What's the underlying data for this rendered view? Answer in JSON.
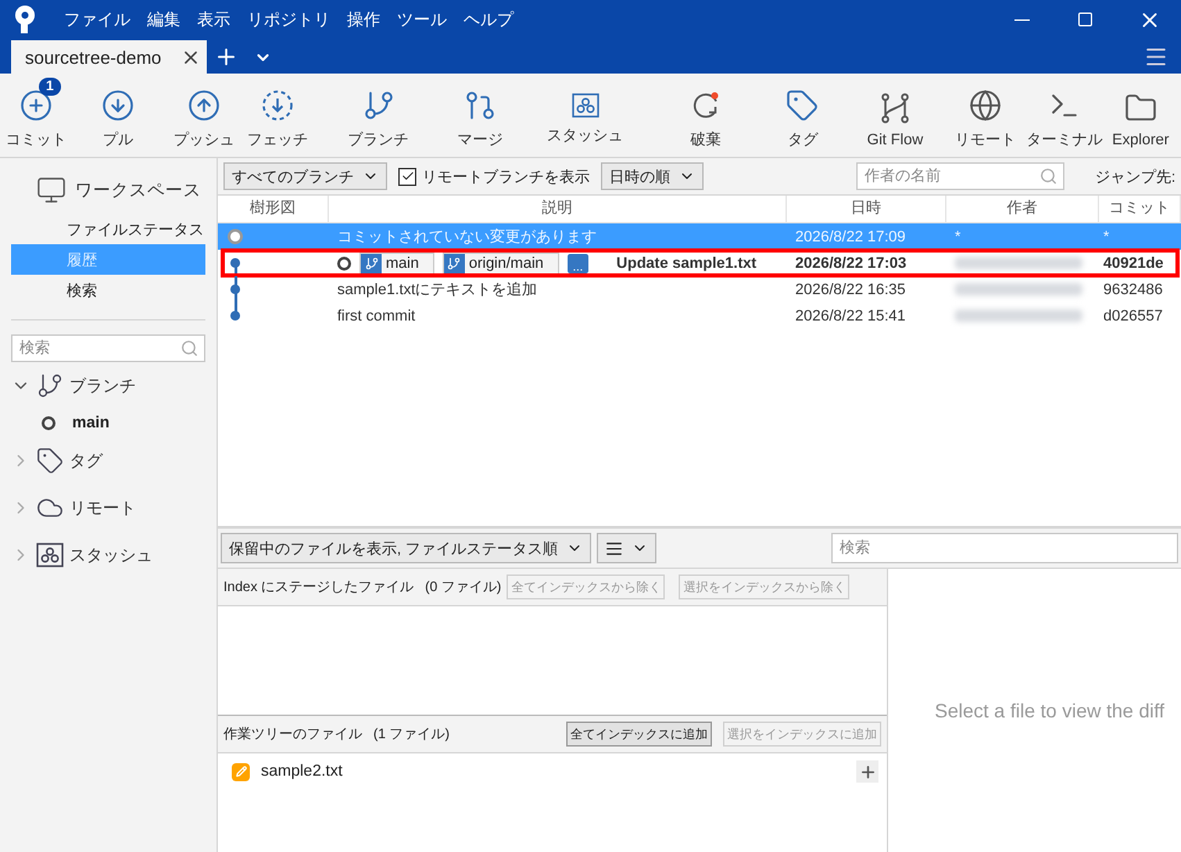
{
  "menu": [
    "ファイル",
    "編集",
    "表示",
    "リポジトリ",
    "操作",
    "ツール",
    "ヘルプ"
  ],
  "tabs": [
    {
      "label": "sourcetree-demo",
      "selected": true
    }
  ],
  "toolbar": [
    {
      "kind": "commit",
      "label": "コミット",
      "badge": "1"
    },
    {
      "kind": "pull",
      "label": "プル"
    },
    {
      "kind": "push",
      "label": "プッシュ"
    },
    {
      "kind": "fetch",
      "label": "フェッチ"
    },
    {
      "kind": "branch",
      "label": "ブランチ"
    },
    {
      "kind": "merge",
      "label": "マージ"
    },
    {
      "kind": "stash",
      "label": "スタッシュ"
    },
    {
      "kind": "discard",
      "label": "破棄"
    },
    {
      "kind": "tag",
      "label": "タグ"
    },
    {
      "kind": "gitflow",
      "label": "Git Flow"
    },
    {
      "kind": "remote",
      "label": "リモート"
    },
    {
      "kind": "terminal",
      "label": "ターミナル"
    },
    {
      "kind": "explorer",
      "label": "Explorer"
    }
  ],
  "sidebar": {
    "workspace": {
      "title": "ワークスペース",
      "items": [
        {
          "label": "ファイルステータス",
          "selected": false
        },
        {
          "label": "履歴",
          "selected": true
        },
        {
          "label": "検索",
          "selected": false
        }
      ]
    },
    "search": {
      "placeholder": "検索"
    },
    "sections": [
      {
        "kind": "branch",
        "label": "ブランチ",
        "expanded": true,
        "children": [
          {
            "label": "main",
            "current": true
          }
        ]
      },
      {
        "kind": "tag",
        "label": "タグ",
        "expanded": false
      },
      {
        "kind": "remote",
        "label": "リモート",
        "expanded": false
      },
      {
        "kind": "stash",
        "label": "スタッシュ",
        "expanded": false
      }
    ]
  },
  "filter_bar": {
    "branches": "すべてのブランチ",
    "show_remote": {
      "label": "リモートブランチを表示",
      "checked": true
    },
    "order": "日時の順",
    "author_search": {
      "placeholder": "作者の名前"
    },
    "jump": "ジャンプ先:"
  },
  "table": {
    "columns": [
      "樹形図",
      "説明",
      "日時",
      "作者",
      "コミット"
    ],
    "rows": [
      {
        "kind": "uncommitted",
        "selected": true,
        "current": false,
        "highlighted": false,
        "description": "コミットされていない変更があります",
        "date": "2026/8/22  17:09",
        "author": "*",
        "commit": "*"
      },
      {
        "kind": "commit",
        "selected": false,
        "current": true,
        "highlighted": true,
        "refs": [
          {
            "kind": "branch",
            "label": "main"
          },
          {
            "kind": "branch",
            "label": "origin/main"
          },
          {
            "kind": "more",
            "label": "..."
          }
        ],
        "description": "Update sample1.txt",
        "date": "2026/8/22  17:03",
        "commit": "40921de"
      },
      {
        "kind": "commit",
        "selected": false,
        "current": false,
        "highlighted": false,
        "description": "sample1.txtにテキストを追加",
        "date": "2026/8/22  16:35",
        "commit": "9632486"
      },
      {
        "kind": "commit",
        "selected": false,
        "current": false,
        "highlighted": false,
        "description": "first commit",
        "date": "2026/8/22  15:41",
        "commit": "d026557"
      }
    ]
  },
  "files_toolbar": {
    "view": "保留中のファイルを表示, ファイルステータス順",
    "search": {
      "placeholder": "検索"
    }
  },
  "staged": {
    "title": "Index にステージしたファイル",
    "count": "(0 ファイル)",
    "buttons": [
      {
        "label": "全てインデックスから除く",
        "disabled": true
      },
      {
        "label": "選択をインデックスから除く",
        "disabled": true
      }
    ]
  },
  "unstaged": {
    "title": "作業ツリーのファイル",
    "count": "(1 ファイル)",
    "buttons": [
      {
        "label": "全てインデックスに追加",
        "disabled": false
      },
      {
        "label": "選択をインデックスに追加",
        "disabled": true
      }
    ],
    "files": [
      {
        "kind": "modified",
        "name": "sample2.txt"
      }
    ]
  },
  "diff": {
    "placeholder": "Select a file to view the diff"
  }
}
